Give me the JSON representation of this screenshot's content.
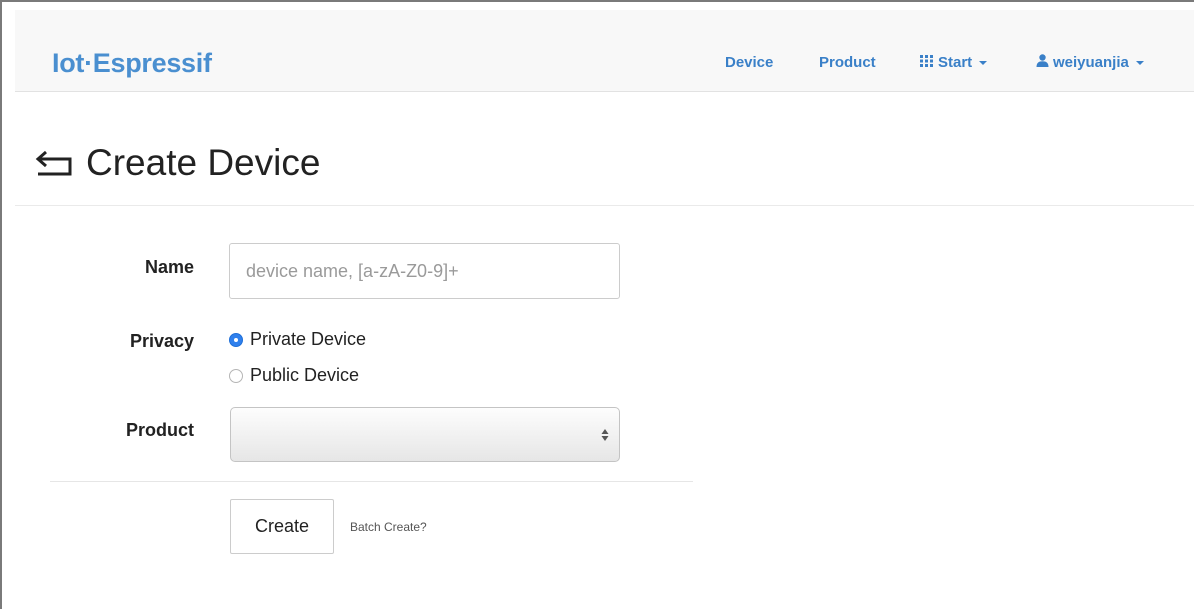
{
  "navbar": {
    "brand": "Iot·Espressif",
    "links": {
      "device": "Device",
      "product": "Product",
      "start": "Start",
      "user": "weiyuanjia"
    },
    "accent_color": "#3a80c8"
  },
  "page": {
    "title": "Create Device"
  },
  "form": {
    "name": {
      "label": "Name",
      "placeholder": "device name, [a-zA-Z0-9]+",
      "value": ""
    },
    "privacy": {
      "label": "Privacy",
      "options": [
        {
          "label": "Private Device",
          "checked": true
        },
        {
          "label": "Public Device",
          "checked": false
        }
      ]
    },
    "product": {
      "label": "Product",
      "selected": ""
    },
    "create_button": "Create",
    "batch_link": "Batch Create?"
  },
  "icons": {
    "back": "back-arrow-icon",
    "start": "grid-icon",
    "user": "user-icon"
  }
}
